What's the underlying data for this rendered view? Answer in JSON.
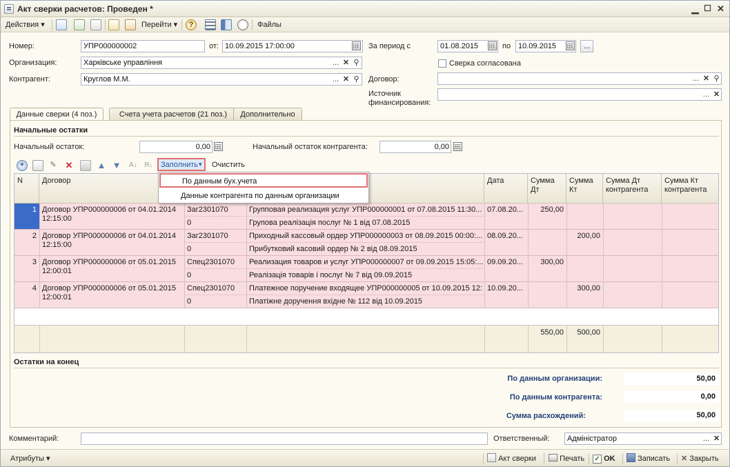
{
  "window": {
    "title": "Акт сверки расчетов: Проведен *"
  },
  "toolbar": {
    "actions_label": "Действия",
    "goto_label": "Перейти",
    "files_label": "Файлы"
  },
  "header": {
    "number_label": "Номер:",
    "number_value": "УПР000000002",
    "date_label": "от:",
    "date_value": "10.09.2015 17:00:00",
    "period_label": "За период с",
    "period_from": "01.08.2015",
    "period_to_label": "по",
    "period_to": "10.09.2015",
    "org_label": "Организация:",
    "org_value": "Харківське управління",
    "agreed_label": "Сверка согласована",
    "counterparty_label": "Контрагент:",
    "counterparty_value": "Круглов М.М.",
    "contract_label": "Договор:",
    "contract_value": "",
    "source_label_1": "Источник",
    "source_label_2": "финансирования:",
    "source_value": ""
  },
  "tabs": [
    {
      "label": "Данные сверки (4 поз.)"
    },
    {
      "label": "Счета учета расчетов (21 поз.)"
    },
    {
      "label": "Дополнительно"
    }
  ],
  "opening": {
    "section_title": "Начальные остатки",
    "balance_label": "Начальный остаток:",
    "balance_value": "0,00",
    "cp_balance_label": "Начальный остаток контрагента:",
    "cp_balance_value": "0,00"
  },
  "grid_toolbar": {
    "fill_label": "Заполнить",
    "clear_label": "Очистить"
  },
  "fill_menu": {
    "items": [
      {
        "label": "По данным бух.учета"
      },
      {
        "label": "Данные контрагента по данным организации"
      }
    ]
  },
  "table": {
    "columns": {
      "n": "N",
      "contract": "Договор",
      "date": "Дата",
      "debit_1": "Сумма",
      "debit_2": "Дт",
      "credit_1": "Сумма",
      "credit_2": "Кт",
      "cp_debit_1": "Сумма Дт",
      "cp_debit_2": "контрагента",
      "cp_credit_1": "Сумма Кт",
      "cp_credit_2": "контрагента"
    },
    "rows": [
      {
        "n": "1",
        "contract_1": "Договор УПР000000006 от 04.01.2014",
        "contract_2": "12:15:00",
        "code_1": "Заг2301070",
        "code_2": "0",
        "doc_1": "Групповая реализация услуг УПР000000001 от 07.08.2015 11:30...",
        "doc_2": "Групова реалізація послуг № 1 від 07.08.2015",
        "date": "07.08.20...",
        "debit": "250,00",
        "credit": ""
      },
      {
        "n": "2",
        "contract_1": "Договор УПР000000006 от 04.01.2014",
        "contract_2": "12:15:00",
        "code_1": "Заг2301070",
        "code_2": "0",
        "doc_1": "Приходный кассовый ордер УПР000000003 от 08.09.2015 00:00:...",
        "doc_2": "Прибутковий касовий ордер № 2 від 08.09.2015",
        "date": "08.09.20...",
        "debit": "",
        "credit": "200,00"
      },
      {
        "n": "3",
        "contract_1": "Договор УПР000000006 от 05.01.2015",
        "contract_2": "12:00:01",
        "code_1": "Спец2301070",
        "code_2": "0",
        "doc_1": "Реализация товаров и услуг УПР000000007 от 09.09.2015 15:05:...",
        "doc_2": "Реалізація товарів і послуг № 7 від 09.09.2015",
        "date": "09.09.20...",
        "debit": "300,00",
        "credit": ""
      },
      {
        "n": "4",
        "contract_1": "Договор УПР000000006 от 05.01.2015",
        "contract_2": "12:00:01",
        "code_1": "Спец2301070",
        "code_2": "0",
        "doc_1": "Платежное поручение входящее УПР000000005 от 10.09.2015 12:...",
        "doc_2": "Платіжне доручення вхідне № 112 від 10.09.2015",
        "date": "10.09.20...",
        "debit": "",
        "credit": "300,00"
      }
    ],
    "totals": {
      "debit": "550,00",
      "credit": "500,00"
    }
  },
  "closing": {
    "section_title": "Остатки на конец",
    "org_label": "По данным организации:",
    "org_value": "50,00",
    "cp_label": "По данным контрагента:",
    "cp_value": "0,00",
    "diff_label": "Сумма расхождений:",
    "diff_value": "50,00"
  },
  "footer": {
    "comment_label": "Комментарий:",
    "comment_value": "",
    "responsible_label": "Ответственный:",
    "responsible_value": "Адміністратор"
  },
  "bottom": {
    "attributes_label": "Атрибуты",
    "act_label": "Акт сверки",
    "print_label": "Печать",
    "ok_label": "OK",
    "save_label": "Записать",
    "close_label": "Закрыть"
  },
  "colors": {
    "row_bg": "#f9dde0",
    "highlight_border": "#e06e74",
    "totals_label": "#23407a",
    "selected_cell": "#3a6bc9"
  }
}
